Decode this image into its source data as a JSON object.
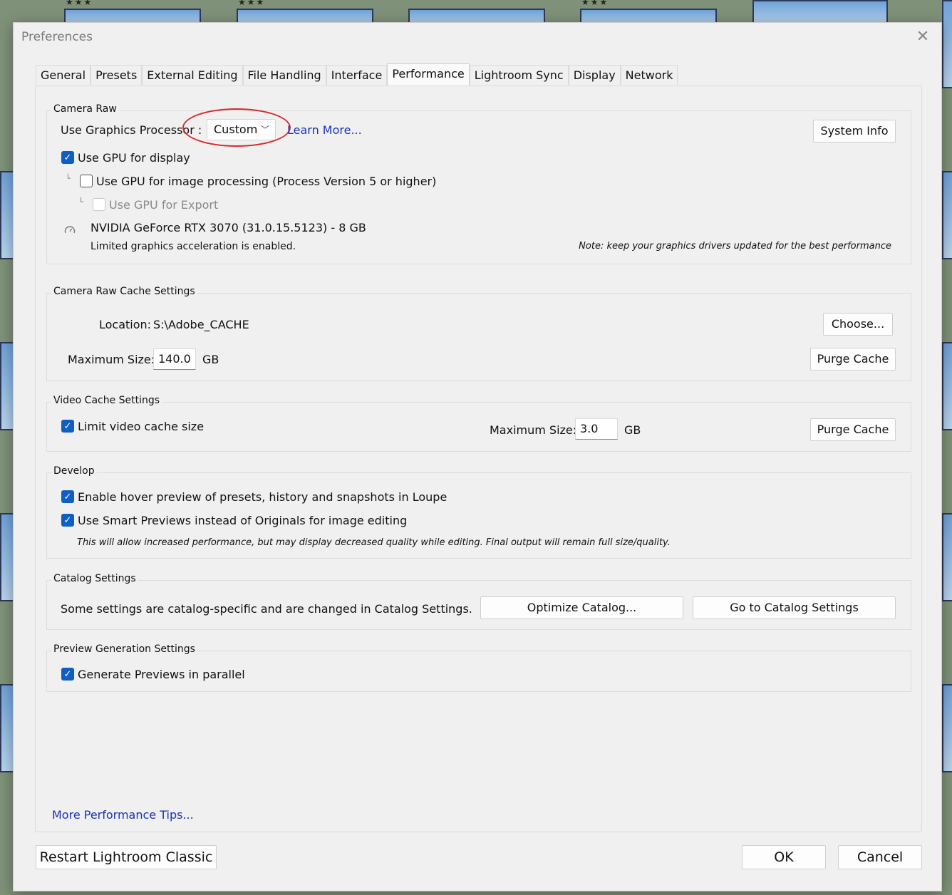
{
  "window": {
    "title": "Preferences",
    "close_icon": "close-icon"
  },
  "tabs": [
    {
      "label": "General"
    },
    {
      "label": "Presets"
    },
    {
      "label": "External Editing"
    },
    {
      "label": "File Handling"
    },
    {
      "label": "Interface"
    },
    {
      "label": "Performance",
      "active": true
    },
    {
      "label": "Lightroom Sync"
    },
    {
      "label": "Display"
    },
    {
      "label": "Network"
    }
  ],
  "camera_raw": {
    "title": "Camera Raw",
    "gpu_label": "Use Graphics Processor :",
    "gpu_value": "Custom",
    "learn_more": "Learn More...",
    "system_info": "System Info",
    "gpu_display": {
      "label": "Use GPU for display",
      "checked": true
    },
    "gpu_processing": {
      "label": "Use GPU for image processing (Process Version 5 or higher)",
      "checked": false
    },
    "gpu_export": {
      "label": "Use GPU for Export",
      "checked": false,
      "disabled": true
    },
    "gpu_name": "NVIDIA GeForce RTX 3070 (31.0.15.5123) - 8 GB",
    "accel_status": "Limited graphics acceleration is enabled.",
    "driver_note": "Note: keep your graphics drivers updated for the best performance",
    "annotation_color": "#d62c2c"
  },
  "cache": {
    "title": "Camera Raw Cache Settings",
    "location_label": "Location:",
    "location_value": "S:\\Adobe_CACHE",
    "choose": "Choose...",
    "max_label": "Maximum Size:",
    "max_value": "140.0",
    "unit": "GB",
    "purge": "Purge Cache"
  },
  "video_cache": {
    "title": "Video Cache Settings",
    "limit": {
      "label": "Limit video cache size",
      "checked": true
    },
    "max_label": "Maximum Size:",
    "max_value": "3.0",
    "unit": "GB",
    "purge": "Purge Cache"
  },
  "develop": {
    "title": "Develop",
    "hover": {
      "label": "Enable hover preview of presets, history and snapshots in Loupe",
      "checked": true
    },
    "smart": {
      "label": "Use Smart Previews instead of Originals for image editing",
      "checked": true
    },
    "note": "This will allow increased performance, but may display decreased quality while editing. Final output will remain full size/quality."
  },
  "catalog": {
    "title": "Catalog Settings",
    "text": "Some settings are catalog-specific and are changed in Catalog Settings.",
    "optimize": "Optimize Catalog...",
    "goto": "Go to Catalog Settings"
  },
  "preview": {
    "title": "Preview Generation Settings",
    "parallel": {
      "label": "Generate Previews in parallel",
      "checked": true
    }
  },
  "more_tips": "More Performance Tips...",
  "footer": {
    "restart": "Restart Lightroom Classic",
    "ok": "OK",
    "cancel": "Cancel"
  },
  "background": {
    "star_rating": "★★★"
  },
  "colors": {
    "accent": "#0f5fc2",
    "link": "#1733b8",
    "dialog_bg": "#f0f0f0"
  }
}
